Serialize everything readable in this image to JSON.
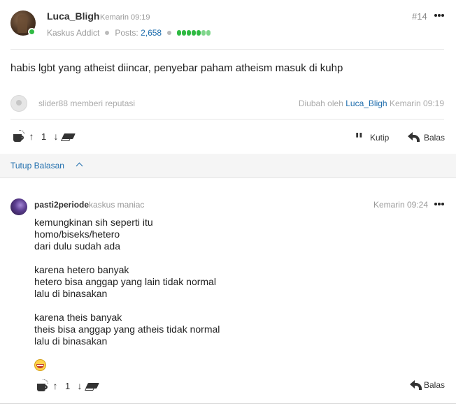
{
  "post": {
    "username": "Luca_Bligh",
    "timestamp": "Kemarin 09:19",
    "post_number": "#14",
    "rank": "Kaskus Addict",
    "posts_label": "Posts:",
    "posts_count": "2,658",
    "reputation_colors": [
      "#2fba43",
      "#2fba43",
      "#2fba43",
      "#2fba43",
      "#2fba43",
      "#7fd68b",
      "#7fd68b"
    ],
    "body": "habis lgbt yang atheist diincar, penyebar paham atheism masuk di kuhp",
    "reputation_note": "slider88 memberi reputasi",
    "edited_prefix": "Diubah oleh",
    "edited_by": "Luca_Bligh",
    "edited_time": "Kemarin 09:19",
    "vote_count": "1",
    "quote_label": "Kutip",
    "reply_label": "Balas"
  },
  "replies_toggle": {
    "label": "Tutup Balasan"
  },
  "reply": {
    "username": "pasti2periode",
    "rank": "kaskus maniac",
    "timestamp": "Kemarin 09:24",
    "lines": [
      "kemungkinan sih seperti itu",
      "homo/biseks/hetero",
      "dari dulu sudah ada",
      "",
      "karena hetero banyak",
      "hetero bisa anggap yang lain tidak normal",
      "lalu di binasakan",
      "",
      "karena theis banyak",
      "theis bisa anggap yang atheis tidak normal",
      "lalu di binasakan"
    ],
    "vote_count": "1",
    "reply_label": "Balas"
  },
  "colors": {
    "link": "#1e6dad",
    "online": "#2fba43",
    "muted": "#999999"
  }
}
